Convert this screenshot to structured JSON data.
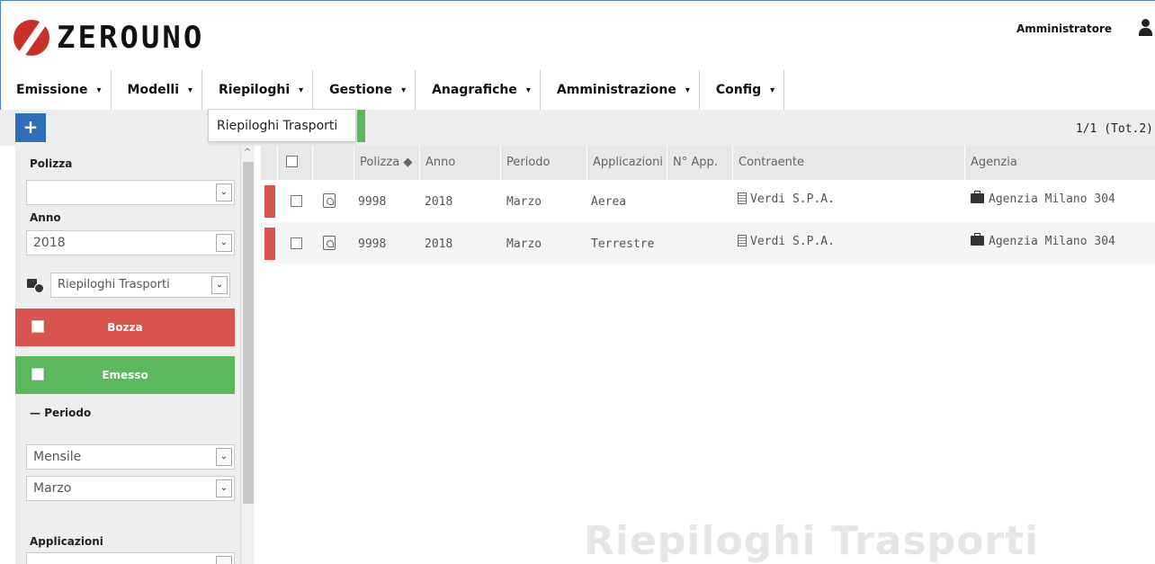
{
  "header": {
    "logo_text": "ZEROUNO",
    "user_name": "Amministratore"
  },
  "nav": [
    {
      "label": "Emissione"
    },
    {
      "label": "Modelli"
    },
    {
      "label": "Riepiloghi"
    },
    {
      "label": "Gestione"
    },
    {
      "label": "Anagrafiche"
    },
    {
      "label": "Amministrazione"
    },
    {
      "label": "Config"
    }
  ],
  "toolbar": {
    "add_label": "+",
    "dropdown_item": "Riepiloghi Trasporti",
    "pagination": "1/1 (Tot.2)"
  },
  "sidebar": {
    "polizza_label": "Polizza",
    "polizza_value": "",
    "anno_label": "Anno",
    "anno_value": "2018",
    "report_value": "Riepiloghi Trasporti",
    "status_bozza": "Bozza",
    "status_emesso": "Emesso",
    "periodo_label": "Periodo",
    "periodo_type": "Mensile",
    "periodo_month": "Marzo",
    "applicazioni_label": "Applicazioni"
  },
  "table": {
    "headers": [
      "Polizza",
      "Anno",
      "Periodo",
      "Applicazioni",
      "N° App.",
      "Contraente",
      "Agenzia"
    ],
    "rows": [
      {
        "polizza": "9998",
        "anno": "2018",
        "periodo": "Marzo",
        "applicazioni": "Aerea",
        "n_app": "",
        "contraente": "Verdi S.P.A.",
        "agenzia": "Agenzia Milano 304"
      },
      {
        "polizza": "9998",
        "anno": "2018",
        "periodo": "Marzo",
        "applicazioni": "Terrestre",
        "n_app": "",
        "contraente": "Verdi S.P.A.",
        "agenzia": "Agenzia Milano 304"
      }
    ]
  },
  "watermark": "Riepiloghi Trasporti",
  "colors": {
    "accent_blue": "#2e6fb5",
    "status_red": "#d9534f",
    "status_green": "#5cb85c"
  }
}
